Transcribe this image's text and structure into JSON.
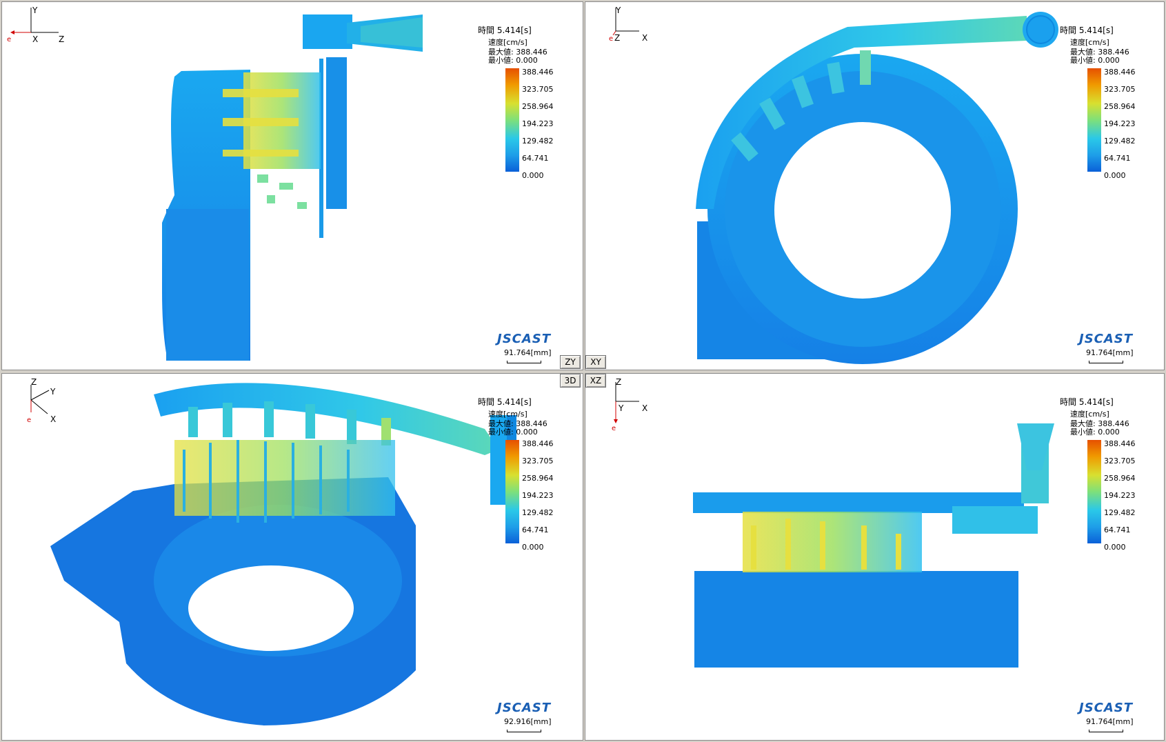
{
  "colors": {
    "accent": "#1a5fb4",
    "max": "#e65000",
    "min": "#0a60d8"
  },
  "legend": {
    "time_label": "時間  5.414[s]",
    "unit_label": "速度[cm/s]",
    "max_label": "最大値: 388.446",
    "min_label": "最小値: 0.000",
    "ticks": [
      "388.446",
      "323.705",
      "258.964",
      "194.223",
      "129.482",
      "64.741",
      "0.000"
    ]
  },
  "brand": "JSCAST",
  "views": {
    "zy": {
      "axes": {
        "up": "Y",
        "left": "X",
        "right": "Z"
      },
      "scale": "91.764[mm]"
    },
    "xy": {
      "axes": {
        "up": "Y",
        "left": "Z",
        "right": "X"
      },
      "scale": "91.764[mm]"
    },
    "d3": {
      "axes": {
        "up": "Z",
        "diag": "Y",
        "down": "X"
      },
      "scale": "92.916[mm]"
    },
    "xz": {
      "axes": {
        "up": "Z",
        "down": "Y",
        "right": "X"
      },
      "scale": "91.764[mm]"
    }
  },
  "buttons": {
    "zy": "ZY",
    "xy": "XY",
    "d3": "3D",
    "xz": "XZ"
  },
  "icons": {
    "axis_origin": "red-e-marker",
    "svg_render": "casting-render"
  }
}
